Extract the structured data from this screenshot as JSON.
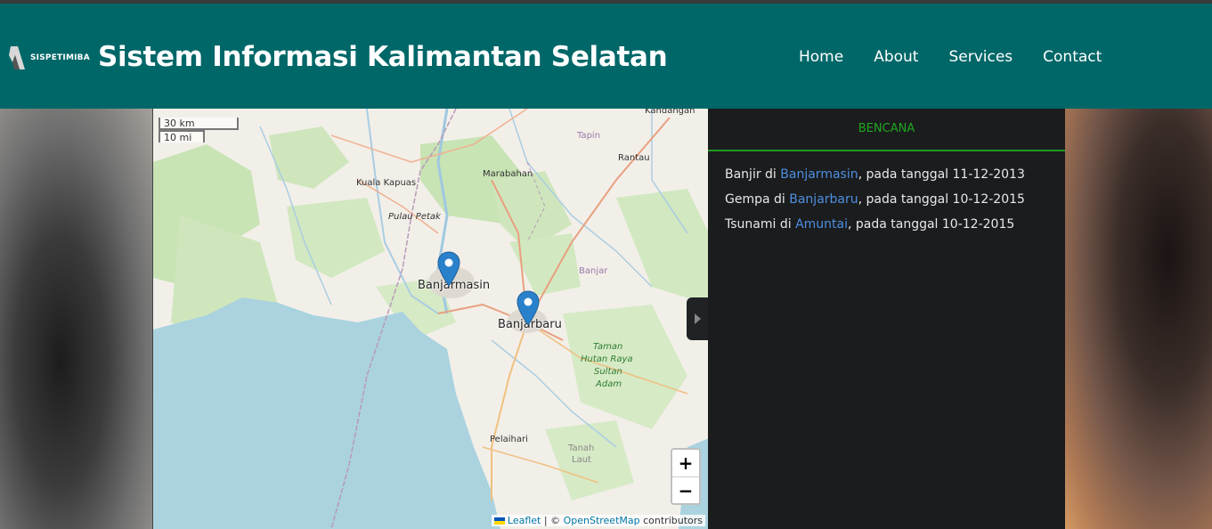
{
  "header": {
    "logo_text": "SISPETIMIBA",
    "title": "Sistem Informasi Kalimantan Selatan",
    "nav": [
      {
        "label": "Home"
      },
      {
        "label": "About"
      },
      {
        "label": "Services"
      },
      {
        "label": "Contact"
      }
    ]
  },
  "map": {
    "scale_km": "30 km",
    "scale_mi": "10 mi",
    "places": {
      "kandangan": "Kandangan",
      "tapin": "Tapin",
      "rantau": "Rantau",
      "marabahan": "Marabahan",
      "kuala_kapuas": "Kuala Kapuas",
      "pulau_petak": "Pulau Petak",
      "banjar": "Banjar",
      "banjarmasin": "Banjarmasin",
      "banjarbaru": "Banjarbaru",
      "taman_1": "Taman",
      "taman_2": "Hutan Raya",
      "taman_3": "Sultan",
      "taman_4": "Adam",
      "pelaihari": "Pelaihari",
      "tanah_1": "Tanah",
      "tanah_2": "Laut"
    },
    "zoom_in": "+",
    "zoom_out": "−",
    "attribution": {
      "leaflet": "Leaflet",
      "sep": " | © ",
      "osm": "OpenStreetMap",
      "suffix": " contributors"
    }
  },
  "panel": {
    "tab": "BENCANA",
    "events": [
      {
        "prefix": "Banjir di ",
        "place": "Banjarmasin",
        "suffix": ", pada tanggal 11-12-2013"
      },
      {
        "prefix": "Gempa di ",
        "place": "Banjarbaru",
        "suffix": ", pada tanggal 10-12-2015"
      },
      {
        "prefix": "Tsunami di ",
        "place": "Amuntai",
        "suffix": ", pada tanggal 10-12-2015"
      }
    ]
  },
  "colors": {
    "navbar": "#006768",
    "panel_bg": "#1b1c1e",
    "tab_accent": "#1fa81f",
    "link": "#4d8fe0",
    "marker": "#2a81cb"
  }
}
